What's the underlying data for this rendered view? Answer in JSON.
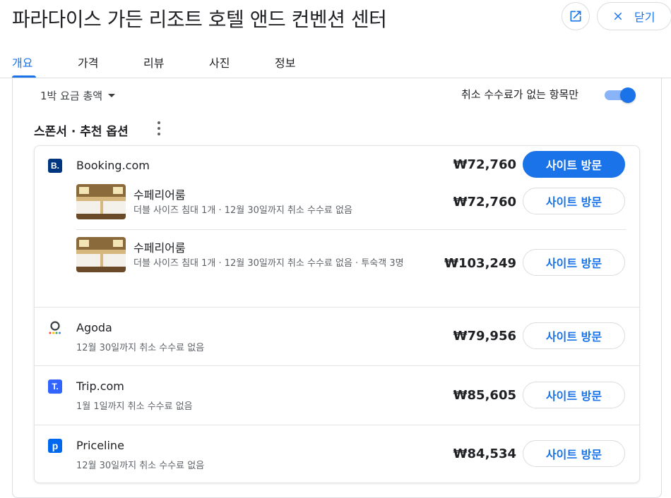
{
  "header": {
    "title": "파라다이스 가든 리조트 호텔 앤드 컨벤션 센터",
    "close_label": "닫기"
  },
  "tabs": [
    {
      "label": "개요",
      "active": true
    },
    {
      "label": "가격",
      "active": false
    },
    {
      "label": "리뷰",
      "active": false
    },
    {
      "label": "사진",
      "active": false
    },
    {
      "label": "정보",
      "active": false
    }
  ],
  "filters": {
    "price_mode": "1박 요금 총액",
    "free_cancel_label": "취소 수수료가 없는 항목만",
    "free_cancel_on": true
  },
  "section": {
    "title": "스폰서 · 추천 옵션"
  },
  "offers": {
    "booking": {
      "name": "Booking.com",
      "price": "₩72,760",
      "button": "사이트 방문",
      "logo": "B.",
      "color": "#003580",
      "rooms": [
        {
          "name": "수페리어룸",
          "desc": "더블 사이즈 침대 1개 · 12월 30일까지 취소 수수료 없음",
          "price": "₩72,760",
          "button": "사이트 방문"
        },
        {
          "name": "수페리어룸",
          "desc": "더블 사이즈 침대 1개 · 12월 30일까지 취소 수수료 없음 · 투숙객 3명",
          "price": "₩103,249",
          "button": "사이트 방문"
        }
      ]
    },
    "agoda": {
      "name": "Agoda",
      "sub": "12월 30일까지 취소 수수료 없음",
      "price": "₩79,956",
      "button": "사이트 방문"
    },
    "trip": {
      "name": "Trip.com",
      "sub": "1월 1일까지 취소 수수료 없음",
      "price": "₩85,605",
      "button": "사이트 방문",
      "logo": "T.",
      "color": "#3264ff"
    },
    "priceline": {
      "name": "Priceline",
      "sub": "12월 30일까지 취소 수수료 없음",
      "price": "₩84,534",
      "button": "사이트 방문",
      "logo": "p",
      "color": "#0068ef"
    }
  }
}
